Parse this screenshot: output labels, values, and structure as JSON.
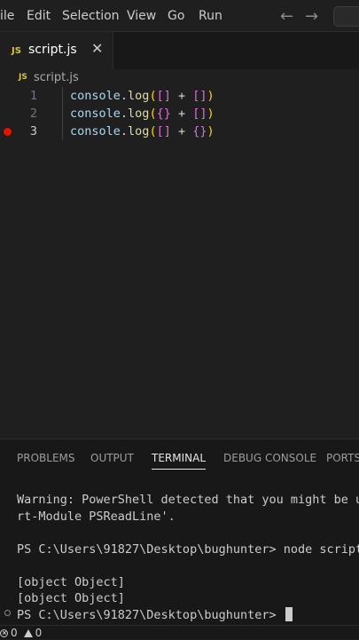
{
  "menu": {
    "items": [
      "ile",
      "Edit",
      "Selection",
      "View",
      "Go",
      "Run"
    ],
    "back_arrow": "←",
    "forward_arrow": "→"
  },
  "tab": {
    "icon": "JS",
    "label": "script.js",
    "close": "✕"
  },
  "breadcrumb": {
    "icon": "JS",
    "label": "script.js"
  },
  "editor": {
    "lines": [
      {
        "number": "1",
        "object": "console",
        "dot": ".",
        "method": "log",
        "open": "(",
        "left": "[]",
        "op": " + ",
        "right": "[]",
        "close": ")"
      },
      {
        "number": "2",
        "object": "console",
        "dot": ".",
        "method": "log",
        "open": "(",
        "left": "{}",
        "op": " + ",
        "right": "[]",
        "close": ")"
      },
      {
        "number": "3",
        "object": "console",
        "dot": ".",
        "method": "log",
        "open": "(",
        "left": "[]",
        "op": " + ",
        "right": "{}",
        "close": ")"
      }
    ],
    "active_line": "3",
    "breakpoint_line": "3"
  },
  "panel": {
    "tabs": [
      "PROBLEMS",
      "OUTPUT",
      "TERMINAL",
      "DEBUG CONSOLE",
      "PORTS"
    ],
    "active_tab": "TERMINAL"
  },
  "terminal": {
    "lines": [
      "Warning: PowerShell detected that you might be usi",
      "rt-Module PSReadLine'.",
      "PS C:\\Users\\91827\\Desktop\\bughunter> node script",
      "[object Object]",
      "[object Object]",
      "PS C:\\Users\\91827\\Desktop\\bughunter> "
    ]
  },
  "status": {
    "errors": "0",
    "warnings": "0"
  }
}
